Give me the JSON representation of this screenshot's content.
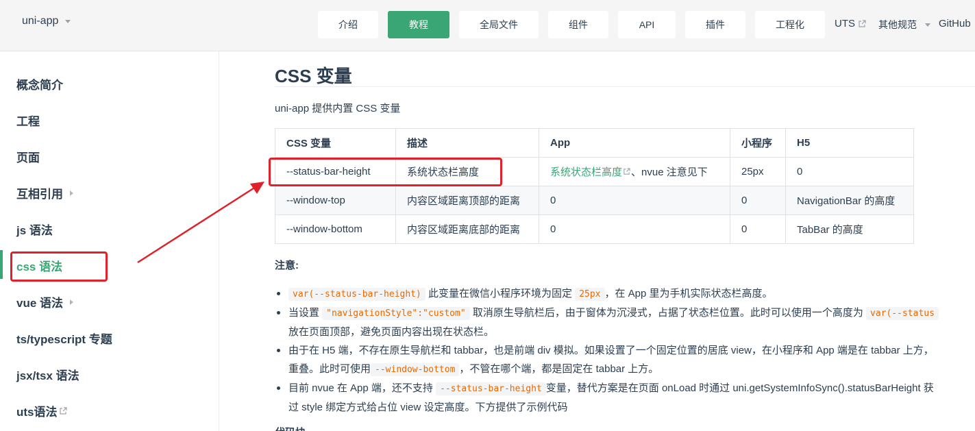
{
  "header": {
    "logo": "uni-app",
    "nav_buttons": [
      {
        "label": "介绍",
        "active": false
      },
      {
        "label": "教程",
        "active": true
      },
      {
        "label": "全局文件",
        "active": false
      },
      {
        "label": "组件",
        "active": false
      },
      {
        "label": "API",
        "active": false
      },
      {
        "label": "插件",
        "active": false
      },
      {
        "label": "工程化",
        "active": false
      }
    ],
    "nav_links": [
      {
        "label": "UTS",
        "external": true
      },
      {
        "label": "其他规范",
        "dropdown": true
      },
      {
        "label": "GitHub",
        "external": false
      }
    ]
  },
  "sidebar": {
    "items": [
      {
        "label": "概念简介",
        "has_children": false,
        "external": false,
        "active": false
      },
      {
        "label": "工程",
        "has_children": false,
        "external": false,
        "active": false
      },
      {
        "label": "页面",
        "has_children": false,
        "external": false,
        "active": false
      },
      {
        "label": "互相引用",
        "has_children": true,
        "external": false,
        "active": false
      },
      {
        "label": "js 语法",
        "has_children": false,
        "external": false,
        "active": false
      },
      {
        "label": "css 语法",
        "has_children": false,
        "external": false,
        "active": true
      },
      {
        "label": "vue 语法",
        "has_children": true,
        "external": false,
        "active": false
      },
      {
        "label": "ts/typescript 专题",
        "has_children": false,
        "external": false,
        "active": false
      },
      {
        "label": "jsx/tsx 语法",
        "has_children": false,
        "external": false,
        "active": false
      },
      {
        "label": "uts语法",
        "has_children": false,
        "external": true,
        "active": false
      }
    ]
  },
  "main": {
    "heading": "CSS 变量",
    "intro": "uni-app 提供内置 CSS 变量",
    "table": {
      "headers": [
        "CSS 变量",
        "描述",
        "App",
        "小程序",
        "H5"
      ],
      "rows": [
        {
          "var": "--status-bar-height",
          "desc": "系统状态栏高度",
          "app_link": "系统状态栏高度",
          "app_rest": "、nvue 注意见下",
          "mp": "25px",
          "h5": "0"
        },
        {
          "var": "--window-top",
          "desc": "内容区域距离顶部的距离",
          "app_link": "",
          "app_rest": "0",
          "mp": "0",
          "h5": "NavigationBar 的高度"
        },
        {
          "var": "--window-bottom",
          "desc": "内容区域距离底部的距离",
          "app_link": "",
          "app_rest": "0",
          "mp": "0",
          "h5": "TabBar 的高度"
        }
      ]
    },
    "note_title": "注意:",
    "notes": {
      "n1": {
        "code1": "var(--status-bar-height)",
        "t1": " 此变量在微信小程序环境为固定 ",
        "code2": "25px",
        "t2": "，在 App 里为手机实际状态栏高度。"
      },
      "n2": {
        "t0": "当设置 ",
        "code1": "\"navigationStyle\":\"custom\"",
        "t1": " 取消原生导航栏后，由于窗体为沉浸式，占据了状态栏位置。此时可以使用一个高度为 ",
        "code2": "var(--status",
        "line2": "放在页面顶部，避免页面内容出现在状态栏。"
      },
      "n3": {
        "t0": "由于在 H5 端，不存在原生导航栏和 tabbar，也是前端 div 模拟。如果设置了一个固定位置的居底 view，在小程序和 App 端是在 tabbar 上方，",
        "l2a": "重叠。此时可使用",
        "code1": "--window-bottom",
        "l2b": "，不管在哪个端，都是固定在 tabbar 上方。"
      },
      "n4": {
        "t0": "目前 nvue 在 App 端，还不支持 ",
        "code1": "--status-bar-height",
        "t1": "变量，替代方案是在页面 onLoad 时通过 uni.getSystemInfoSync().statusBarHeight 获",
        "line2": "过 style 绑定方式给占位 view 设定高度。下方提供了示例代码"
      }
    },
    "bottom_peek": "代码块"
  },
  "annotation": {
    "color": "#e0202a"
  },
  "colors": {
    "accent": "#3aa675",
    "text": "#2c3e50",
    "code": "#e96900"
  }
}
